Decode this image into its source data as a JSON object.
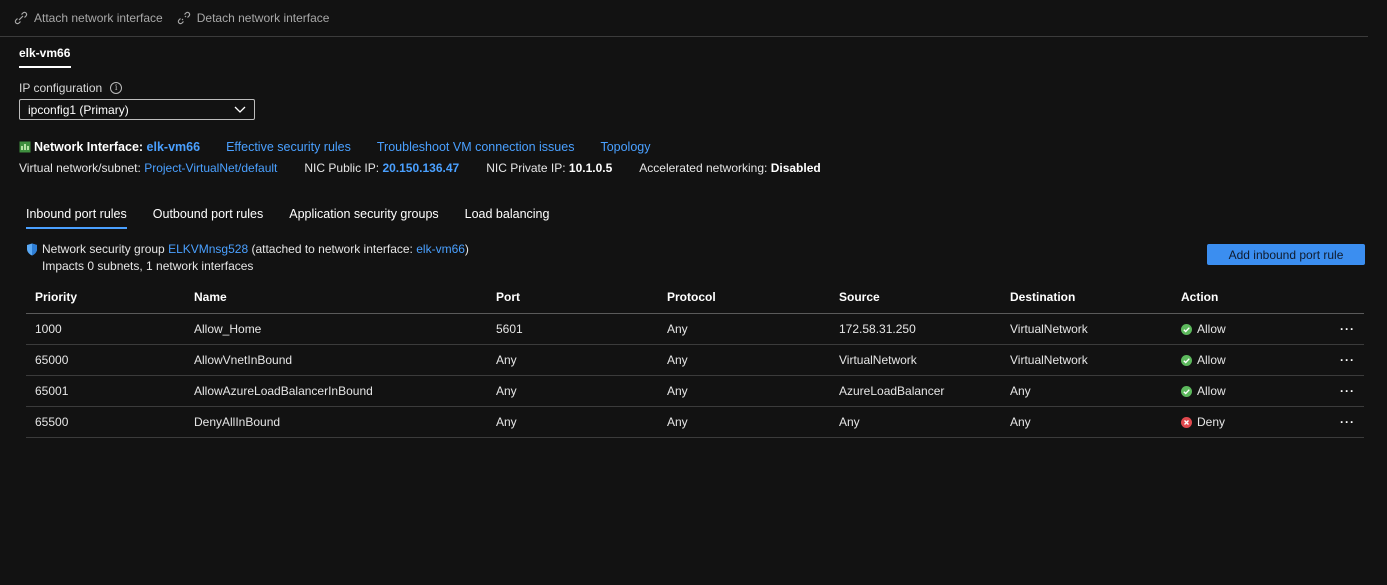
{
  "toolbar": {
    "attach_label": "Attach network interface",
    "detach_label": "Detach network interface"
  },
  "vm_tab": "elk-vm66",
  "ip_config": {
    "label": "IP configuration",
    "selected": "ipconfig1 (Primary)"
  },
  "network_interface": {
    "prefix": "Network Interface:",
    "name": "elk-vm66",
    "links": [
      "Effective security rules",
      "Troubleshoot VM connection issues",
      "Topology"
    ]
  },
  "details": {
    "vnet_label": "Virtual network/subnet:",
    "vnet_value": "Project-VirtualNet/default",
    "public_ip_label": "NIC Public IP:",
    "public_ip_value": "20.150.136.47",
    "private_ip_label": "NIC Private IP:",
    "private_ip_value": "10.1.0.5",
    "accel_label": "Accelerated networking:",
    "accel_value": "Disabled"
  },
  "rule_tabs": [
    "Inbound port rules",
    "Outbound port rules",
    "Application security groups",
    "Load balancing"
  ],
  "nsg": {
    "prefix": "Network security group",
    "name": "ELKVMnsg528",
    "attached_text": "(attached to network interface:",
    "attached_nic": "elk-vm66",
    "close": ")",
    "impacts": "Impacts 0 subnets, 1 network interfaces"
  },
  "add_button": "Add inbound port rule",
  "table": {
    "columns": [
      "Priority",
      "Name",
      "Port",
      "Protocol",
      "Source",
      "Destination",
      "Action"
    ],
    "rows": [
      {
        "priority": "1000",
        "name": "Allow_Home",
        "port": "5601",
        "protocol": "Any",
        "source": "172.58.31.250",
        "destination": "VirtualNetwork",
        "action": "Allow",
        "action_icon": "check-circle-icon"
      },
      {
        "priority": "65000",
        "name": "AllowVnetInBound",
        "port": "Any",
        "protocol": "Any",
        "source": "VirtualNetwork",
        "destination": "VirtualNetwork",
        "action": "Allow",
        "action_icon": "check-circle-icon"
      },
      {
        "priority": "65001",
        "name": "AllowAzureLoadBalancerInBound",
        "port": "Any",
        "protocol": "Any",
        "source": "AzureLoadBalancer",
        "destination": "Any",
        "action": "Allow",
        "action_icon": "check-circle-icon"
      },
      {
        "priority": "65500",
        "name": "DenyAllInBound",
        "port": "Any",
        "protocol": "Any",
        "source": "Any",
        "destination": "Any",
        "action": "Deny",
        "action_icon": "x-circle-icon"
      }
    ],
    "more_label": "···"
  },
  "colors": {
    "link": "#4aa0ff",
    "allow": "#5cb85c",
    "deny": "#e0484d",
    "primary_button": "#3b8ef0"
  }
}
